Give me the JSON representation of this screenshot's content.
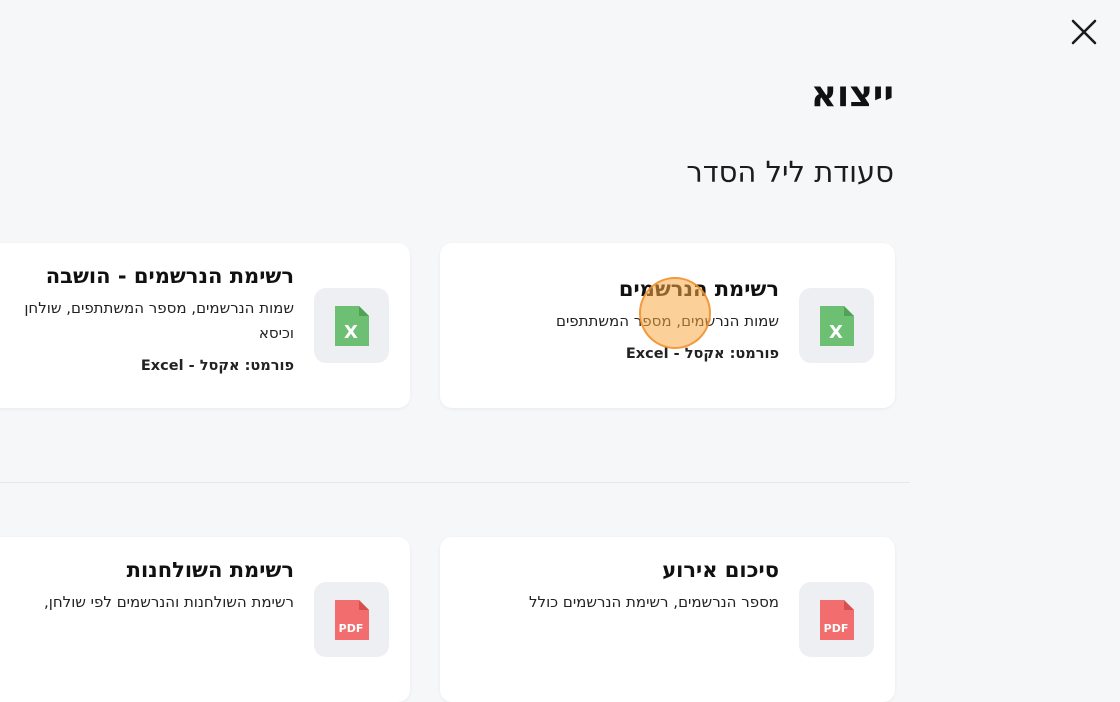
{
  "header": {
    "title": "ייצוא",
    "subtitle": "סעודת ליל הסדר"
  },
  "cards": [
    {
      "title": "רשימת הנרשמים",
      "description": "שמות הנרשמים, מספר המשתתפים",
      "format": "פורמט: אקסל - Excel",
      "icon": "excel-file-icon",
      "icon_color": "#6dbf73"
    },
    {
      "title": "רשימת הנרשמים - הושבה",
      "description": "שמות הנרשמים, מספר המשתתפים, שולחן וכיסא",
      "format": "פורמט: אקסל - Excel",
      "icon": "excel-file-icon",
      "icon_color": "#6dbf73"
    },
    {
      "title": "סיכום אירוע",
      "description": "מספר הנרשמים, רשימת הנרשמים כולל",
      "icon": "pdf-file-icon",
      "icon_color": "#f26d6d"
    },
    {
      "title": "רשימת השולחנות",
      "description": "רשימת השולחנות והנרשמים לפי שולחן,",
      "icon": "pdf-file-icon",
      "icon_color": "#f26d6d"
    }
  ],
  "icons": {
    "close": "close-icon",
    "excel_letter": "X",
    "pdf_letter": "PDF"
  },
  "colors": {
    "background": "#f6f7f9",
    "card": "#ffffff",
    "icon_box": "#eeeff3"
  }
}
